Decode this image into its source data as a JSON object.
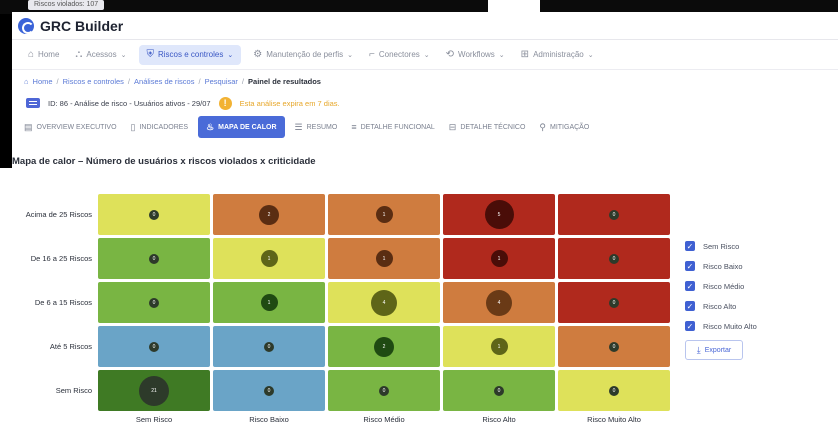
{
  "background": {
    "chip_text": "Riscos violados: 107"
  },
  "app": {
    "title": "GRC Builder"
  },
  "nav": {
    "items": [
      {
        "label": "Home",
        "icon": "home-icon",
        "glyph": "⌂",
        "active": false,
        "chevron": false
      },
      {
        "label": "Acessos",
        "icon": "access-icon",
        "glyph": "⛬",
        "active": false,
        "chevron": true
      },
      {
        "label": "Riscos e controles",
        "icon": "shield-icon",
        "glyph": "⛨",
        "active": true,
        "chevron": true
      },
      {
        "label": "Manutenção de perfis",
        "icon": "gear-icon",
        "glyph": "⚙",
        "active": false,
        "chevron": true
      },
      {
        "label": "Conectores",
        "icon": "connector-icon",
        "glyph": "⌐",
        "active": false,
        "chevron": true
      },
      {
        "label": "Workflows",
        "icon": "workflow-icon",
        "glyph": "⟲",
        "active": false,
        "chevron": true
      },
      {
        "label": "Administração",
        "icon": "admin-icon",
        "glyph": "⊞",
        "active": false,
        "chevron": true
      }
    ]
  },
  "breadcrumb": {
    "items": [
      "Home",
      "Riscos e controles",
      "Análises de riscos",
      "Pesquisar"
    ],
    "current": "Painel de resultados"
  },
  "analysis": {
    "title": "ID: 86 - Análise de risco - Usuários ativos - 29/07",
    "warning": "Esta análise expira em 7 dias."
  },
  "tabs": [
    {
      "label": "OVERVIEW EXECUTIVO",
      "icon": "overview-icon",
      "glyph": "▤",
      "active": false
    },
    {
      "label": "INDICADORES",
      "icon": "indicators-icon",
      "glyph": "▯",
      "active": false
    },
    {
      "label": "MAPA DE CALOR",
      "icon": "heatmap-icon",
      "glyph": "♨",
      "active": true
    },
    {
      "label": "RESUMO",
      "icon": "summary-icon",
      "glyph": "☰",
      "active": false
    },
    {
      "label": "DETALHE FUNCIONAL",
      "icon": "functional-icon",
      "glyph": "≡",
      "active": false
    },
    {
      "label": "DETALHE TÉCNICO",
      "icon": "technical-icon",
      "glyph": "⊟",
      "active": false
    },
    {
      "label": "MITIGAÇÃO",
      "icon": "mitigation-icon",
      "glyph": "⚲",
      "active": false
    }
  ],
  "heatmap": {
    "title": "Mapa de calor – Número de usuários x riscos violados x criticidade",
    "rows": [
      "Acima de 25 Riscos",
      "De 16 a 25 Riscos",
      "De 6 a 15 Riscos",
      "Até 5 Riscos",
      "Sem Risco"
    ],
    "columns": [
      "Sem Risco",
      "Risco Baixo",
      "Risco Médio",
      "Risco Alto",
      "Risco Muito Alto"
    ],
    "colors": {
      "yellow": "#dee15a",
      "orange": "#cf7c3f",
      "red": "#b0291d",
      "green": "#79b543",
      "blue": "#6aa4c7",
      "darkgreen": "#3f7a24"
    },
    "cell_colors": [
      [
        "yellow",
        "orange",
        "orange",
        "red",
        "red"
      ],
      [
        "green",
        "yellow",
        "orange",
        "red",
        "red"
      ],
      [
        "green",
        "green",
        "yellow",
        "orange",
        "red"
      ],
      [
        "blue",
        "blue",
        "green",
        "yellow",
        "orange"
      ],
      [
        "darkgreen",
        "blue",
        "green",
        "green",
        "yellow"
      ]
    ],
    "values": [
      [
        0,
        2,
        1,
        5,
        0
      ],
      [
        0,
        1,
        1,
        1,
        0
      ],
      [
        0,
        1,
        4,
        4,
        0
      ],
      [
        0,
        0,
        2,
        1,
        0
      ],
      [
        21,
        0,
        0,
        0,
        0
      ]
    ],
    "bubble_tone": [
      [
        "dark",
        "darkbrown",
        "darkbrown",
        "darkred",
        "dark"
      ],
      [
        "dark",
        "olive",
        "darkbrown",
        "darkred",
        "dark"
      ],
      [
        "dark",
        "darkgreen",
        "olive",
        "brown",
        "dark"
      ],
      [
        "dark",
        "dark",
        "darkgreen",
        "olive",
        "dark"
      ],
      [
        "dark",
        "dark",
        "dark",
        "dark",
        "dark"
      ]
    ]
  },
  "legend": {
    "items": [
      "Sem Risco",
      "Risco Baixo",
      "Risco Médio",
      "Risco Alto",
      "Risco Muito Alto"
    ],
    "export_label": "Exportar"
  }
}
